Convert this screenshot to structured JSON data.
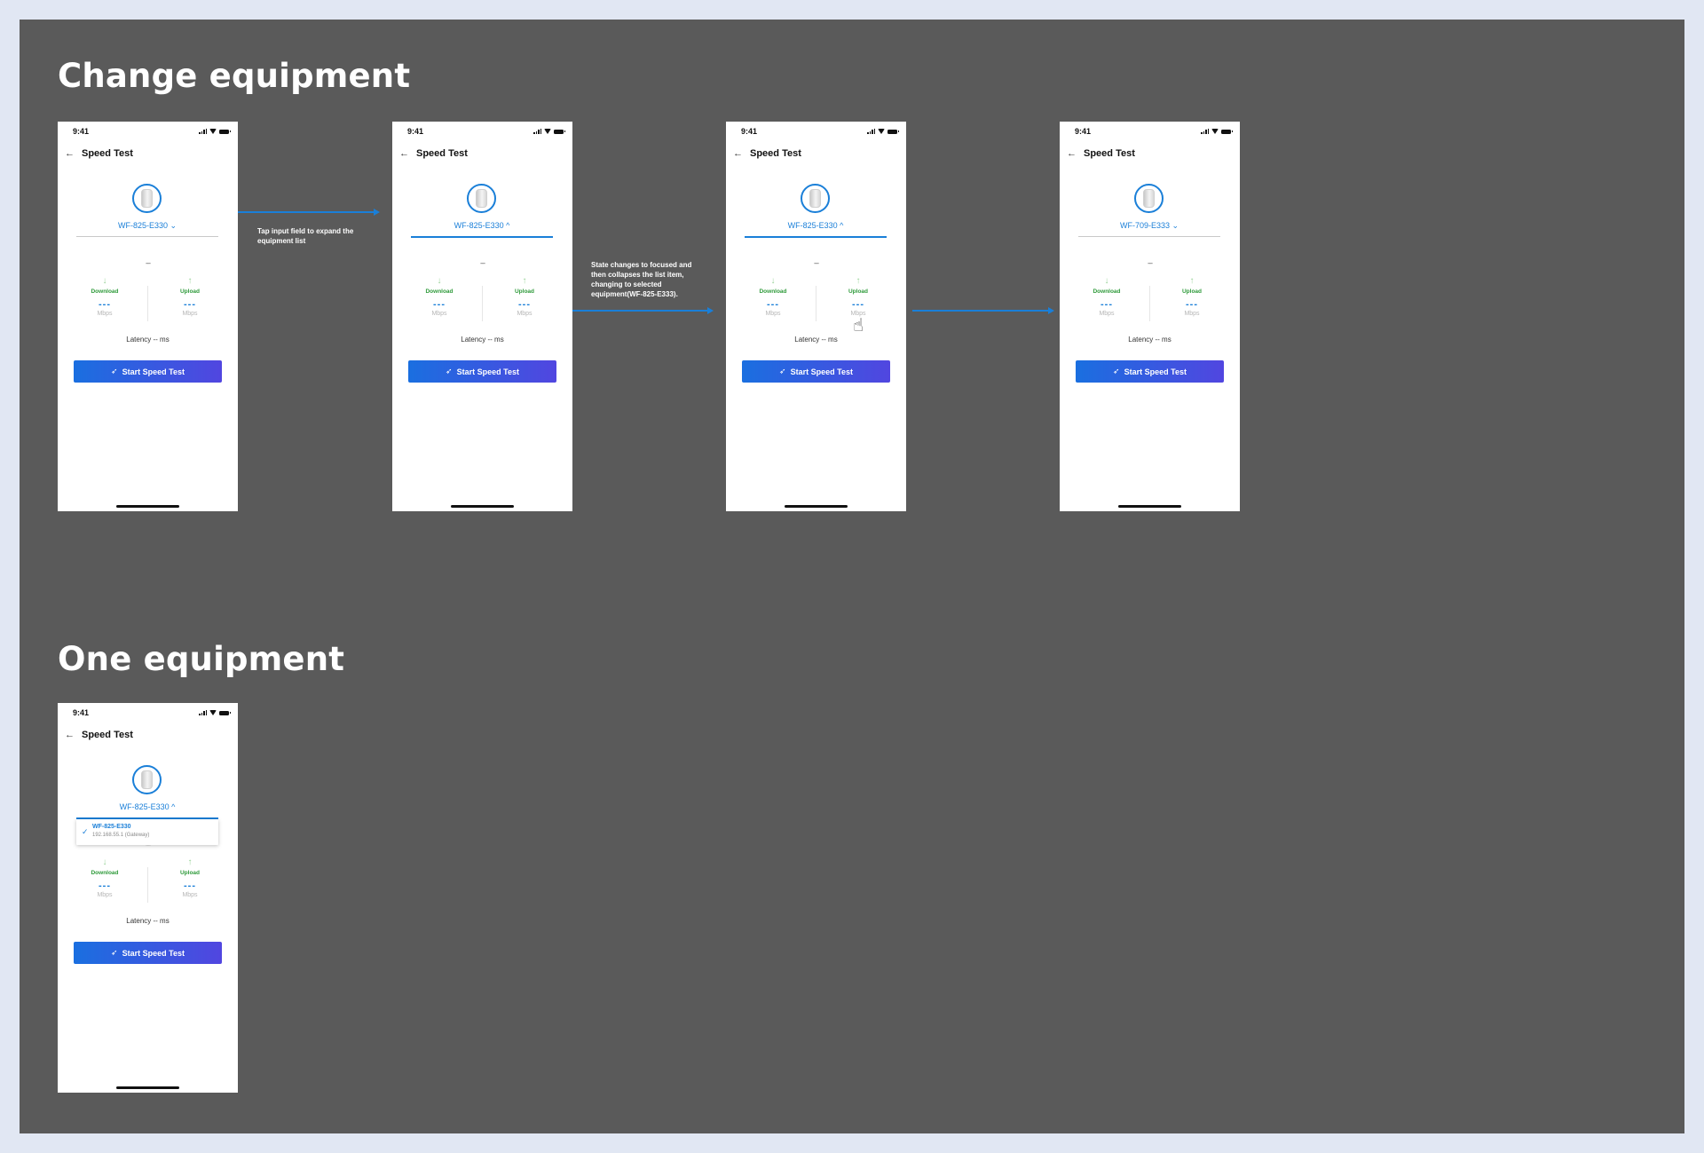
{
  "sections": {
    "change_equipment": "Change equipment",
    "one_equipment": "One equipment"
  },
  "phone": {
    "time": "9:41",
    "title": "Speed Test",
    "dashes": "---",
    "download_label": "Download",
    "upload_label": "Upload",
    "value_placeholder": "---",
    "unit": "Mbps",
    "latency": "Latency -- ms",
    "start_button": "Start Speed Test"
  },
  "screens": [
    {
      "device": "WF-825-E330",
      "chevron": "⌄"
    },
    {
      "device": "WF-825-E330",
      "chevron": "^"
    },
    {
      "device": "WF-825-E330",
      "chevron": "^"
    },
    {
      "device": "WF-709-E333",
      "chevron": "⌄"
    },
    {
      "device": "WF-825-E330",
      "chevron": "^"
    }
  ],
  "dropdown": {
    "name": "WF-825-E330",
    "sub": "192.168.55.1 (Gateway)"
  },
  "notes": {
    "tap": "Tap input field to expand the equipment list",
    "state": "State changes to focused and then collapses the list item, changing to selected equipment(WF-825-E333)."
  },
  "icons": {
    "back": "arrow-left-icon",
    "download": "arrow-down-icon",
    "upload": "arrow-up-icon",
    "rocket": "rocket-icon",
    "check": "check-icon",
    "cursor": "hand-pointer-icon"
  },
  "colors": {
    "canvas": "#5a5a5a",
    "accent": "#1a7fd8",
    "green": "#2e9a3a"
  }
}
